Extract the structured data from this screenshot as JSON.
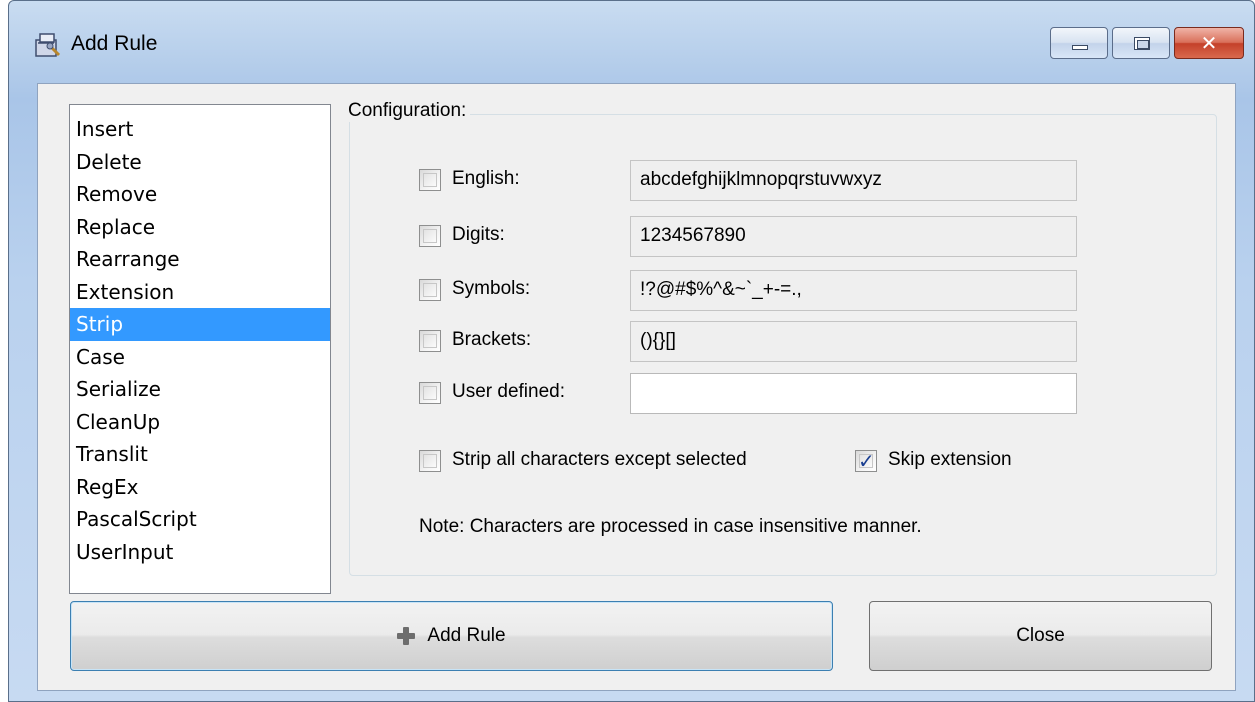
{
  "window": {
    "title": "Add Rule",
    "app_icon": "toolbox-icon"
  },
  "rule_list": {
    "items": [
      "Insert",
      "Delete",
      "Remove",
      "Replace",
      "Rearrange",
      "Extension",
      "Strip",
      "Case",
      "Serialize",
      "CleanUp",
      "Translit",
      "RegEx",
      "PascalScript",
      "UserInput"
    ],
    "selected": "Strip"
  },
  "config": {
    "label": "Configuration:",
    "rows": [
      {
        "label": "English:",
        "value": "abcdefghijklmnopqrstuvwxyz",
        "checked": false,
        "editable": false
      },
      {
        "label": "Digits:",
        "value": "1234567890",
        "checked": false,
        "editable": false
      },
      {
        "label": "Symbols:",
        "value": "!?@#$%^&~`_+-=.,",
        "checked": false,
        "editable": false
      },
      {
        "label": "Brackets:",
        "value": "(){}[]",
        "checked": false,
        "editable": false
      },
      {
        "label": "User defined:",
        "value": "",
        "checked": false,
        "editable": true
      }
    ],
    "strip_except_label": "Strip all characters except selected",
    "strip_except_checked": false,
    "skip_extension_label": "Skip extension",
    "skip_extension_checked": true,
    "note": "Note: Characters are processed in case insensitive manner."
  },
  "buttons": {
    "add_rule": "Add Rule",
    "close": "Close"
  }
}
